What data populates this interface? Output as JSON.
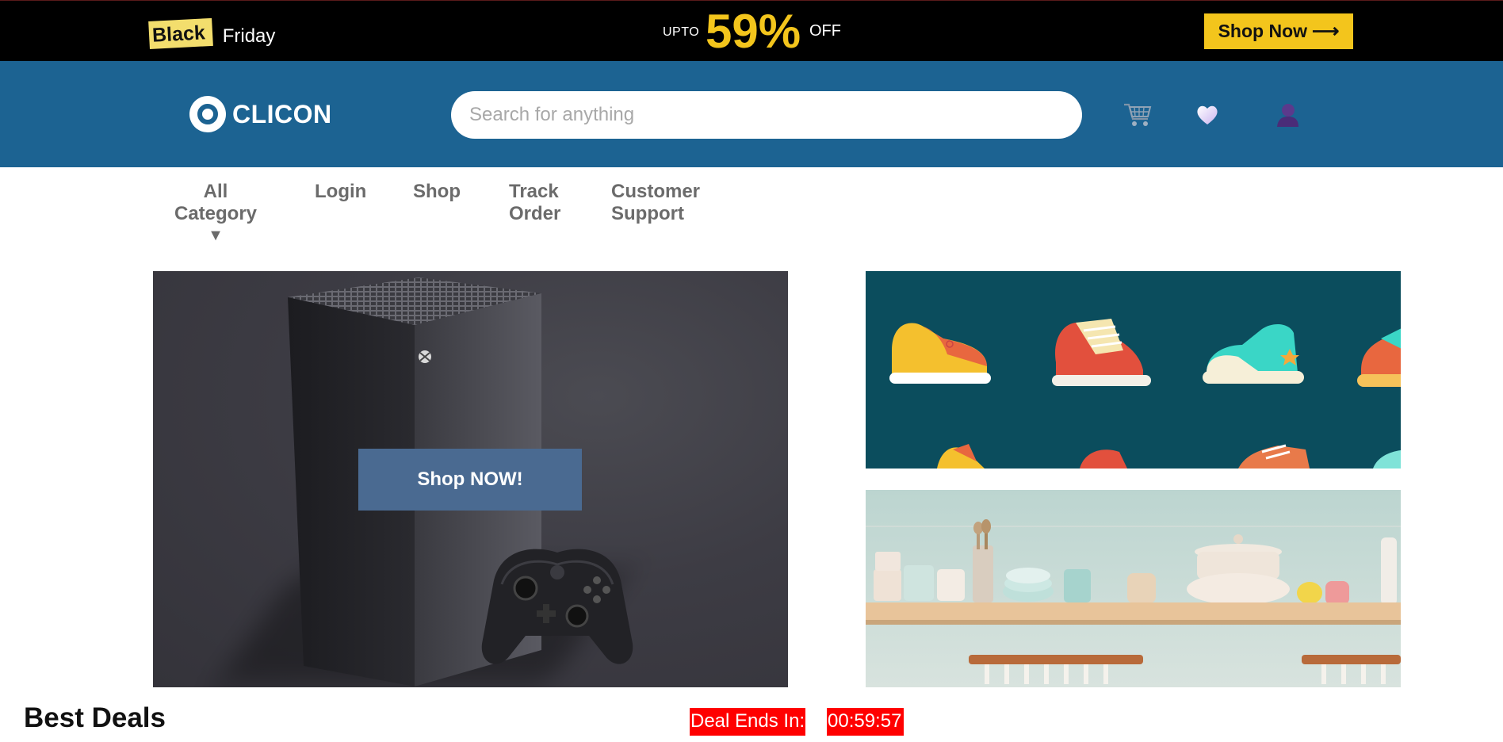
{
  "promo": {
    "black": "Black",
    "friday": "Friday",
    "upto": "UPTO",
    "percent": "59%",
    "off": "OFF",
    "button_label": "Shop Now",
    "button_arrow": "⟶",
    "accent_color": "#f3c51c"
  },
  "header": {
    "brand": "CLICON",
    "search_placeholder": "Search for anything",
    "background_color": "#1c6392",
    "icons": [
      "cart-icon",
      "heart-icon",
      "user-icon"
    ]
  },
  "nav": {
    "all_category": "All Category",
    "caret": "▼",
    "login": "Login",
    "shop": "Shop",
    "track_order": "Track Order",
    "customer_support": "Customer Support"
  },
  "hero": {
    "main_button": "Shop NOW!"
  },
  "deals": {
    "title": "Best Deals",
    "ends_label": "Deal Ends In:",
    "timer": "00:59:57",
    "badge_color": "#ff0000"
  }
}
